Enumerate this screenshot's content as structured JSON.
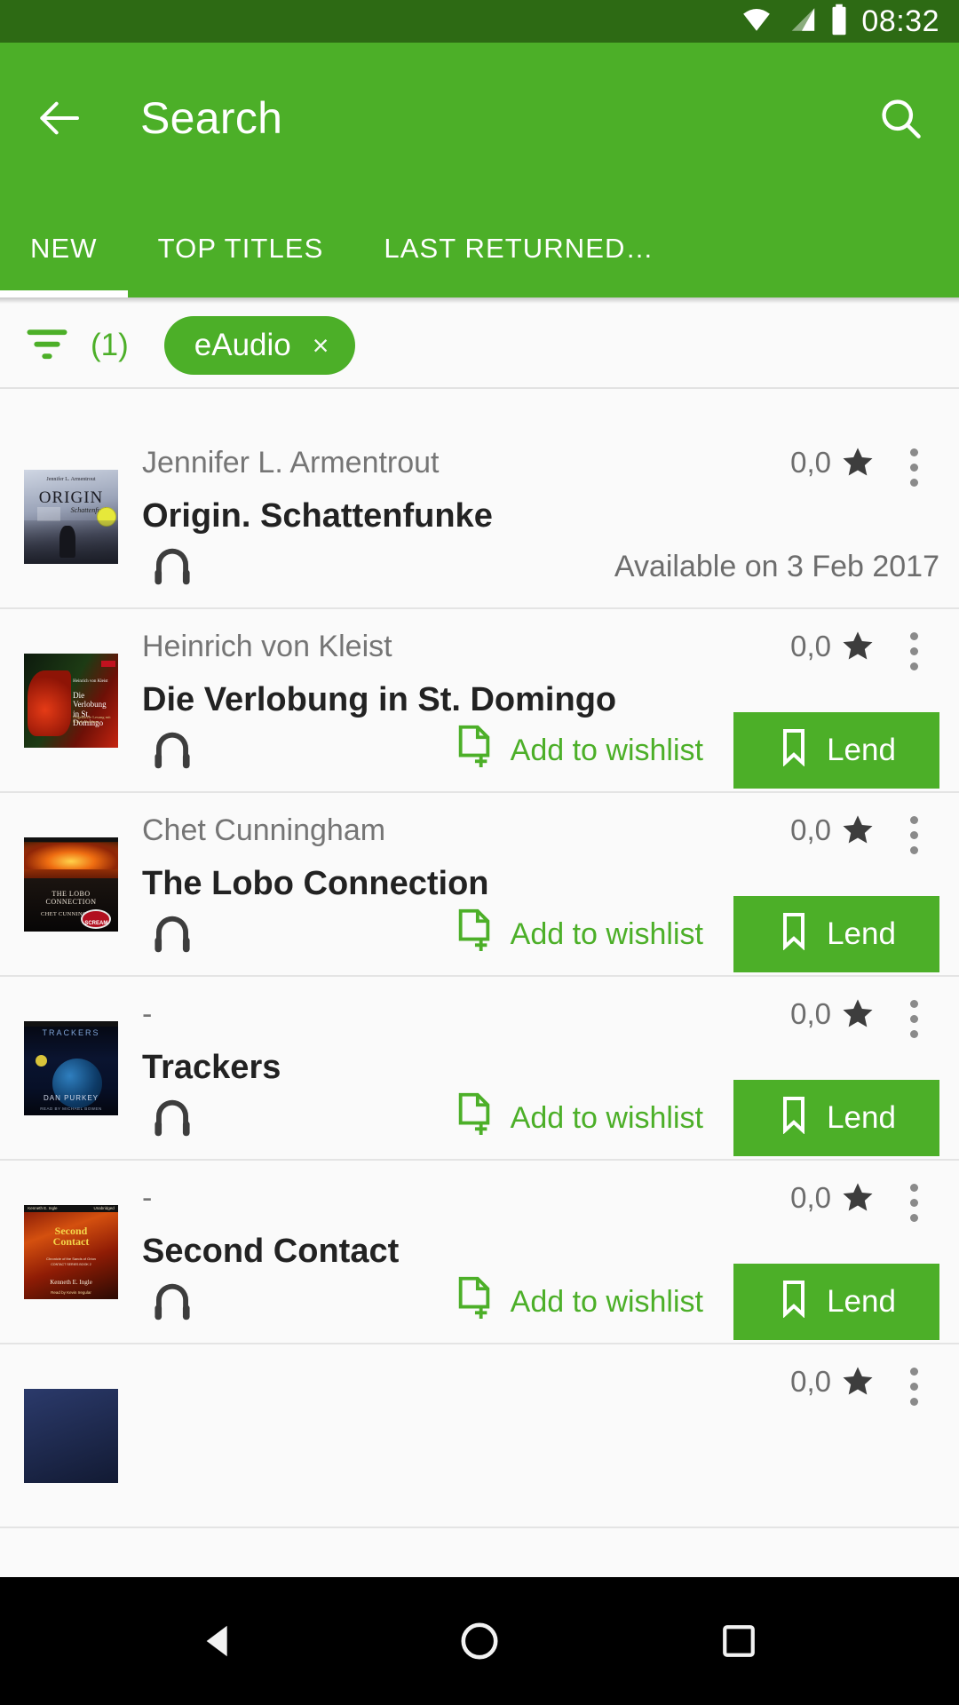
{
  "status_bar": {
    "time": "08:32",
    "icons": [
      "wifi-icon",
      "signal-icon",
      "battery-icon"
    ],
    "background": "#2d6a14"
  },
  "app_bar": {
    "title": "Search",
    "back_icon": "back-arrow-icon",
    "search_icon": "search-icon",
    "background": "#4caf28",
    "tabs": [
      {
        "label": "NEW",
        "active": true
      },
      {
        "label": "TOP TITLES",
        "active": false
      },
      {
        "label": "LAST RETURNED…",
        "active": false
      }
    ]
  },
  "filter_bar": {
    "icon": "filter-icon",
    "count": "(1)",
    "chips": [
      {
        "label": "eAudio",
        "remove": "×"
      }
    ],
    "accent": "#4caf28"
  },
  "labels": {
    "wishlist": "Add to wishlist",
    "lend": "Lend"
  },
  "results": [
    {
      "author": "Jennifer L. Armentrout",
      "title": "Origin. Schattenfunke",
      "rating": "0,0",
      "format_icon": "headphones-icon",
      "status": "Available on 3 Feb 2017",
      "has_actions": false,
      "cover": {
        "title": "ORIGIN",
        "subtitle": "Schattenfunke",
        "author": "Jennifer L. Armentrout",
        "badge": "UNGE-\nKÜRZT"
      }
    },
    {
      "author": "Heinrich von Kleist",
      "title": "Die Verlobung in St. Domingo",
      "rating": "0,0",
      "format_icon": "headphones-icon",
      "status": "",
      "has_actions": true,
      "cover": {
        "title": "Die Verlobung in St. Domingo",
        "subtitle": "",
        "author": "Heinrich von Kleist",
        "badge": ""
      }
    },
    {
      "author": "Chet Cunningham",
      "title": "The Lobo Connection",
      "rating": "0,0",
      "format_icon": "headphones-icon",
      "status": "",
      "has_actions": true,
      "cover": {
        "title": "THE LOBO CONNECTION",
        "subtitle": "SCREAM",
        "author": "CHET CUNNINGHAM",
        "badge": ""
      }
    },
    {
      "author": "-",
      "title": "Trackers",
      "rating": "0,0",
      "format_icon": "headphones-icon",
      "status": "",
      "has_actions": true,
      "cover": {
        "title": "TRACKERS",
        "subtitle": "",
        "author": "DAN PURKEY",
        "badge": ""
      }
    },
    {
      "author": "-",
      "title": "Second Contact",
      "rating": "0,0",
      "format_icon": "headphones-icon",
      "status": "",
      "has_actions": true,
      "cover": {
        "title": "Second Contact",
        "subtitle": "",
        "author": "Kenneth E. Ingle",
        "badge": ""
      }
    },
    {
      "author": "",
      "title": "",
      "rating": "0,0",
      "format_icon": "headphones-icon",
      "status": "",
      "has_actions": true,
      "cover": {
        "title": "",
        "subtitle": "",
        "author": "",
        "badge": ""
      }
    }
  ],
  "nav_bar": {
    "background": "#000000",
    "keys": [
      "back-triangle-icon",
      "home-circle-icon",
      "recents-square-icon"
    ]
  }
}
